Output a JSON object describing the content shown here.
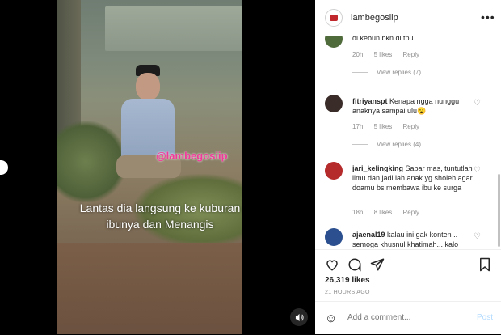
{
  "video": {
    "watermark": "@lambegosiip",
    "caption": "Lantas dia langsung ke kuburan ibunya dan Menangis"
  },
  "header": {
    "username": "lambegosiip",
    "more_label": "•••"
  },
  "comments": [
    {
      "username": "",
      "text": "di kebun bkn di tpu",
      "time": "20h",
      "likes": "5 likes",
      "reply": "Reply",
      "view_replies": "View replies (7)",
      "avatar_color": "#4f6b3b"
    },
    {
      "username": "fitriyanspt",
      "text": "Kenapa ngga nunggu anaknya sampai ulu😮",
      "time": "17h",
      "likes": "5 likes",
      "reply": "Reply",
      "view_replies": "View replies (4)",
      "avatar_color": "#3a2c28"
    },
    {
      "username": "jari_kelingking",
      "text": "Sabar mas, tuntutlah ilmu dan jadi lah anak yg sholeh agar doamu bs membawa ibu ke surga",
      "time": "18h",
      "likes": "8 likes",
      "reply": "Reply",
      "avatar_color": "#b52a2a"
    },
    {
      "username": "ajaenal19",
      "text": "kalau ini gak konten .. semoga khusnul khatimah... kalo",
      "avatar_color": "#2b4f8f"
    }
  ],
  "post": {
    "likes": "26,319 likes",
    "time_ago": "21 HOURS AGO"
  },
  "add_comment": {
    "placeholder": "Add a comment...",
    "post_label": "Post"
  },
  "icons": {
    "heart": "heart-icon",
    "comment": "comment-icon",
    "share": "share-icon",
    "bookmark": "bookmark-icon",
    "emoji": "emoji-icon",
    "audio": "speaker-icon"
  },
  "colors": {
    "watermark": "#f03a9a",
    "post_button": "#b3dbff",
    "meta_text": "#8e8e8e"
  }
}
